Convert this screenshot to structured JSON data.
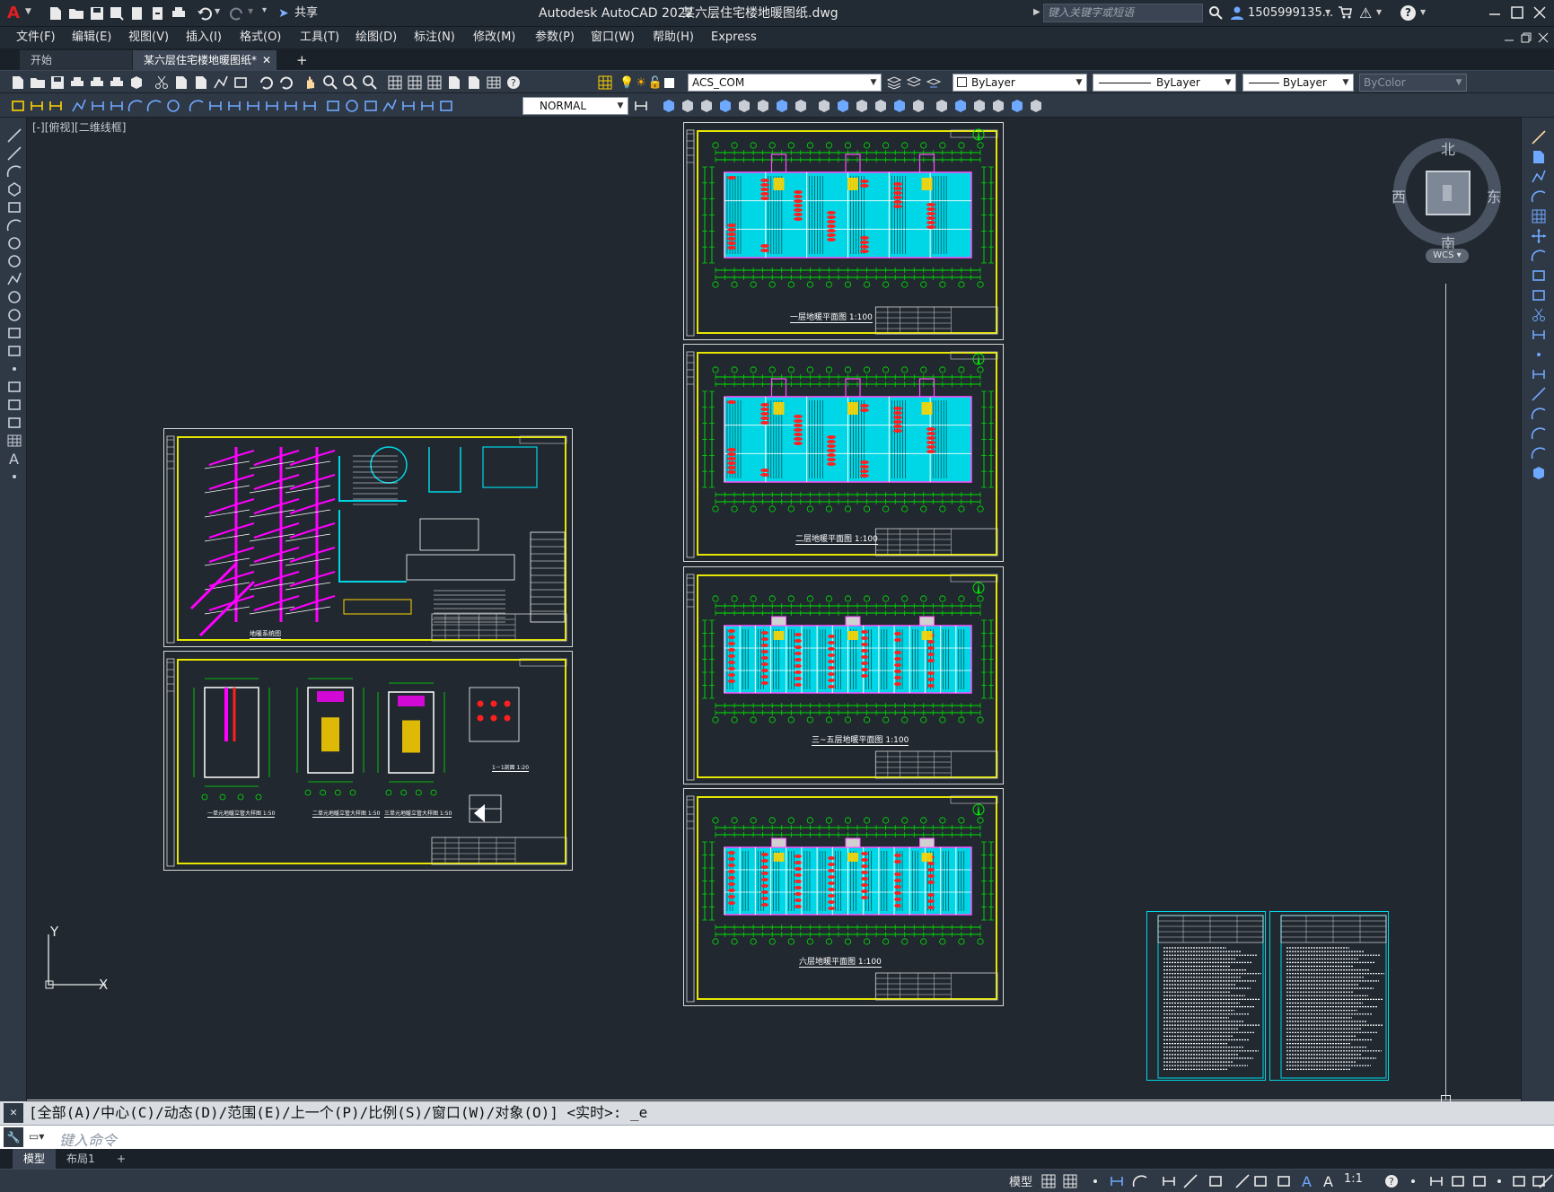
{
  "window": {
    "app_title": "Autodesk AutoCAD 2022",
    "file_title": "某六层住宅楼地暖图纸.dwg",
    "search_placeholder": "键入关键字或短语",
    "user_name": "1505999135...",
    "share_label": "共享",
    "help_icon": "question-icon"
  },
  "menu": {
    "items": [
      "文件(F)",
      "编辑(E)",
      "视图(V)",
      "插入(I)",
      "格式(O)",
      "工具(T)",
      "绘图(D)",
      "标注(N)",
      "修改(M)",
      "参数(P)",
      "窗口(W)",
      "帮助(H)",
      "Express"
    ]
  },
  "doc_tabs": {
    "start_label": "开始",
    "active_label": "某六层住宅楼地暖图纸*",
    "add_label": "+"
  },
  "toolbar": {
    "layer_combo": "ACS_COM",
    "color_combo": "ByLayer",
    "linetype_combo": "ByLayer",
    "lineweight_combo": "ByLayer",
    "plotstyle_combo": "ByColor",
    "text_style_combo": "NORMAL"
  },
  "viewport": {
    "label": "[-][俯视][二维线框]",
    "viewcube": {
      "north": "北",
      "south": "南",
      "east": "东",
      "west": "西",
      "wcs": "WCS"
    },
    "ucs": {
      "x": "X",
      "y": "Y"
    }
  },
  "sheets": {
    "floor1": "一层地暖平面图 1:100",
    "floor2": "二层地暖平面图 1:100",
    "floor3": "三~五层地暖平面图 1:100",
    "floor6": "六层地暖平面图 1:100",
    "system_title": "地暖系统图",
    "detail_a": "一单元地暖立管大样图 1:50",
    "detail_b": "二单元地暖立管大样图 1:50",
    "detail_c": "三单元地暖立管大样图 1:50",
    "section_1_1": "1－1剖面 1:20"
  },
  "command": {
    "history": "[全部(A)/中心(C)/动态(D)/范围(E)/上一个(P)/比例(S)/窗口(W)/对象(O)] <实时>: _e",
    "input_placeholder": "键入命令"
  },
  "layout_tabs": {
    "model": "模型",
    "layout1": "布局1",
    "add": "+"
  },
  "status": {
    "model_label": "模型",
    "scale": "1:1"
  },
  "colors": {
    "canvas_bg": "#212830",
    "frame_yellow": "#e6e600",
    "heating_cyan": "#00d7e6",
    "pipe_red": "#ff2020",
    "magenta": "#ff00ff",
    "green": "#00e600"
  }
}
